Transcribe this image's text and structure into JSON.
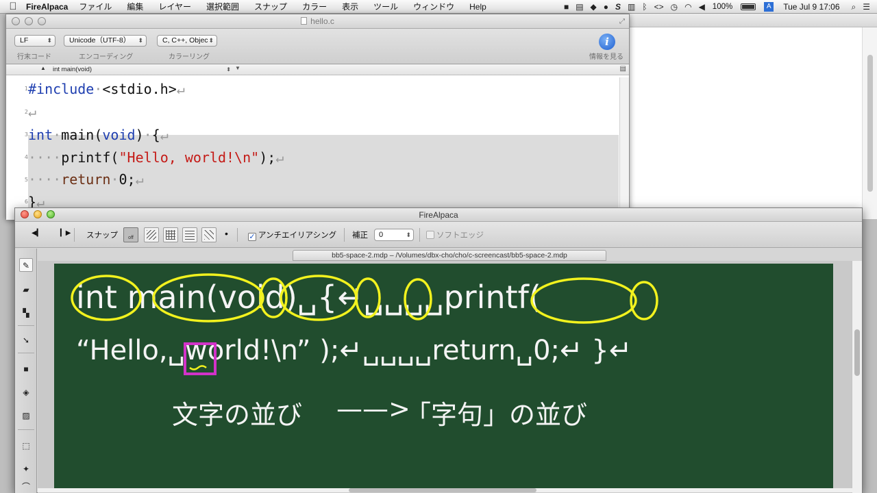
{
  "menubar": {
    "app": "FireAlpaca",
    "items": [
      "ファイル",
      "編集",
      "レイヤー",
      "選択範囲",
      "スナップ",
      "カラー",
      "表示",
      "ツール",
      "ウィンドウ",
      "Help"
    ],
    "battery": "100%",
    "clock": "Tue Jul 9  17:06"
  },
  "editor": {
    "title": "hello.c",
    "line_ending": "LF",
    "encoding": "Unicode（UTF-8）",
    "coloring": "C, C++, Objec",
    "label_line_ending": "行末コード",
    "label_encoding": "エンコーディング",
    "label_coloring": "カラーリング",
    "label_info": "情報を見る",
    "function_nav": "int main(void)",
    "line_numbers": [
      "1",
      "2",
      "3",
      "4",
      "5",
      "6"
    ],
    "lines": [
      {
        "kw": "#include",
        "rest": "<stdio.h>"
      },
      {},
      {
        "kw": "int",
        "name": "main(",
        "kw2": "void",
        "rest": ")",
        "brace": "{"
      },
      {
        "fn": "printf(",
        "str": "\"Hello, world!\\n\"",
        "rest": ");"
      },
      {
        "kw": "return",
        "num": "0",
        "rest": ";"
      },
      {
        "rest": "}"
      }
    ],
    "return_glyph": "↵",
    "space_glyph": "·"
  },
  "firealpaca": {
    "title": "FireAlpaca",
    "snap_label": "スナップ",
    "snap_off": "off",
    "antialias_label": "アンチエイリアシング",
    "correction_label": "補正",
    "correction_value": "0",
    "soft_edge_label": "ソフトエッジ",
    "doc_tab": "bb5-space-2.mdp – /Volumes/dbx-cho/cho/c-screencast/bb5-space-2.mdp",
    "accent_yellow": "#f2f21e",
    "accent_magenta": "#d232c8",
    "board_color": "#214d2e"
  },
  "board": {
    "tokens_row1": [
      "int",
      "main",
      "(",
      "void",
      ")",
      "{",
      "printf",
      "("
    ],
    "row1_text": "int main(void)␣{↵␣␣␣␣printf(",
    "row2_text": "“Hello,␣world!\\n” );↵␣␣␣␣return␣0;↵ }↵",
    "row3_left": "文字の並び",
    "row3_arrow": "——>",
    "row3_right": "「字句」の並び"
  }
}
